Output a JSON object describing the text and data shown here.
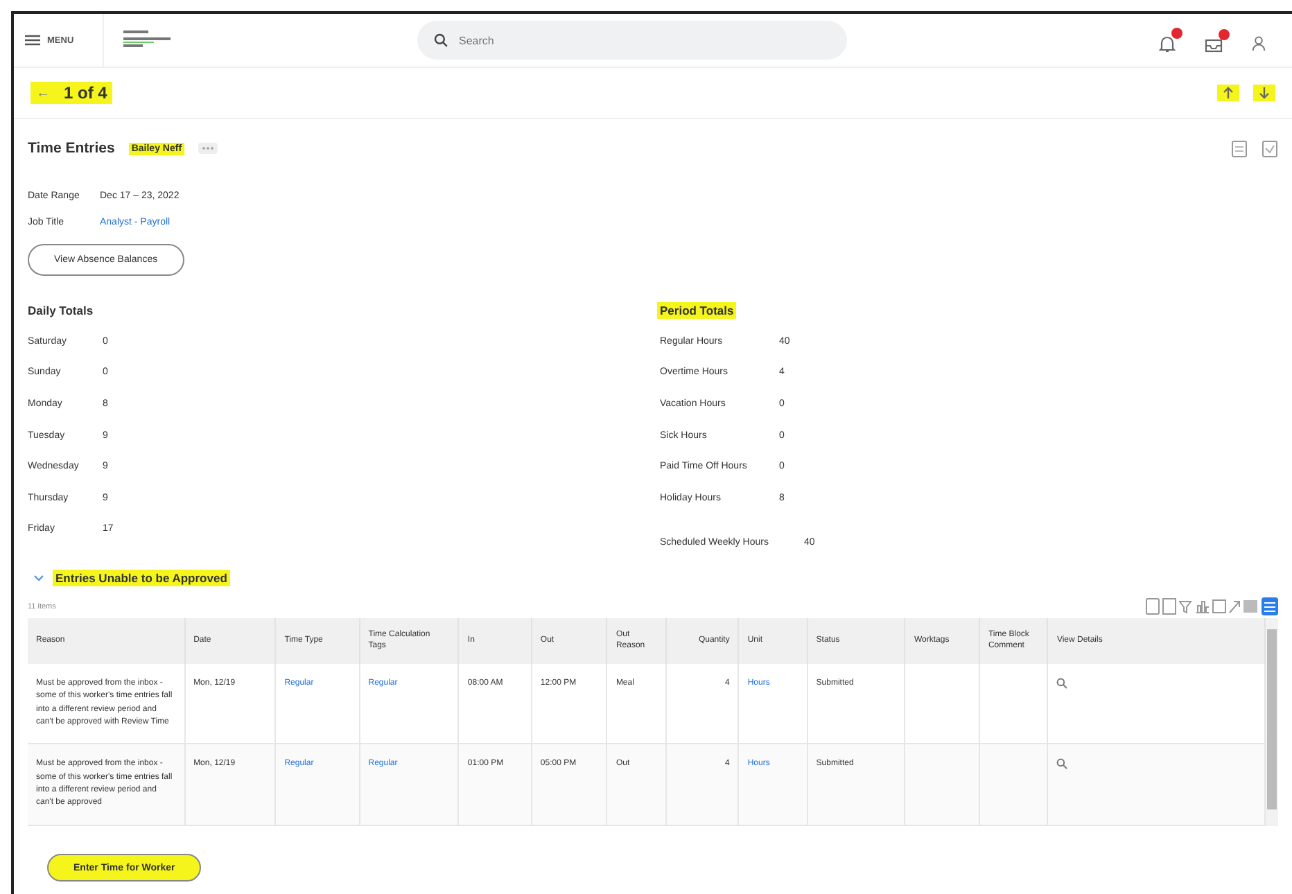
{
  "header": {
    "menu_label": "MENU",
    "search": {
      "placeholder": "Search"
    }
  },
  "pager": {
    "arrow": "←",
    "label": "1 of 4",
    "highlight": true
  },
  "title": "Time Entries",
  "worker": {
    "name": "Bailey Neff",
    "highlight": true
  },
  "fields": [
    {
      "label": "Date Range",
      "value": "Dec 17 – 23, 2022",
      "kind": "text"
    },
    {
      "label": "Job Title",
      "value": "Analyst - Payroll",
      "kind": "link"
    }
  ],
  "absence_button": "View Absence Balances",
  "daily_totals": {
    "title": "Daily Totals",
    "highlight": false,
    "rows": [
      {
        "label": "Saturday",
        "value": "0"
      },
      {
        "label": "Sunday",
        "value": "0"
      },
      {
        "label": "Monday",
        "value": "8"
      },
      {
        "label": "Tuesday",
        "value": "9"
      },
      {
        "label": "Wednesday",
        "value": "9"
      },
      {
        "label": "Thursday",
        "value": "9"
      },
      {
        "label": "Friday",
        "value": "17"
      }
    ]
  },
  "period_totals": {
    "title": "Period Totals",
    "highlight": true,
    "rows": [
      {
        "label": "Regular Hours",
        "value": "40"
      },
      {
        "label": "Overtime Hours",
        "value": "4"
      },
      {
        "label": "Vacation Hours",
        "value": "0"
      },
      {
        "label": "Sick Hours",
        "value": "0"
      },
      {
        "label": "Paid Time Off Hours",
        "value": "0"
      },
      {
        "label": "Holiday Hours",
        "value": "8"
      }
    ],
    "scheduled": {
      "label": "Scheduled Weekly Hours",
      "value": "40"
    }
  },
  "entries": {
    "title": "Entries Unable to be Approved",
    "highlight": true,
    "expanded": true,
    "count": "11 items",
    "table": {
      "columns": [
        "Reason",
        "Date",
        "Time Type",
        "Time Calculation Tags",
        "In",
        "Out",
        "Out Reason",
        "Quantity",
        "Unit",
        "Status",
        "Worktags",
        "Time Block Comment",
        "View Details"
      ],
      "rows": [
        {
          "reason": "Must be approved from the inbox - some of this worker's time entries fall into a different review period and can't be approved with Review Time",
          "date": "Mon, 12/19",
          "time_type": "Regular",
          "tags": "Regular",
          "in": "08:00 AM",
          "out": "12:00 PM",
          "out_reason": "Meal",
          "quantity": "4",
          "unit": "Hours",
          "status": "Submitted"
        },
        {
          "reason": "Must be approved from the inbox - some of this worker's time entries fall into a different review period and can't be approved",
          "date": "Mon, 12/19",
          "time_type": "Regular",
          "tags": "Regular",
          "in": "01:00 PM",
          "out": "05:00 PM",
          "out_reason": "Out",
          "quantity": "4",
          "unit": "Hours",
          "status": "Submitted"
        }
      ]
    }
  },
  "footer_button": {
    "label": "Enter Time for Worker",
    "highlight": true
  }
}
